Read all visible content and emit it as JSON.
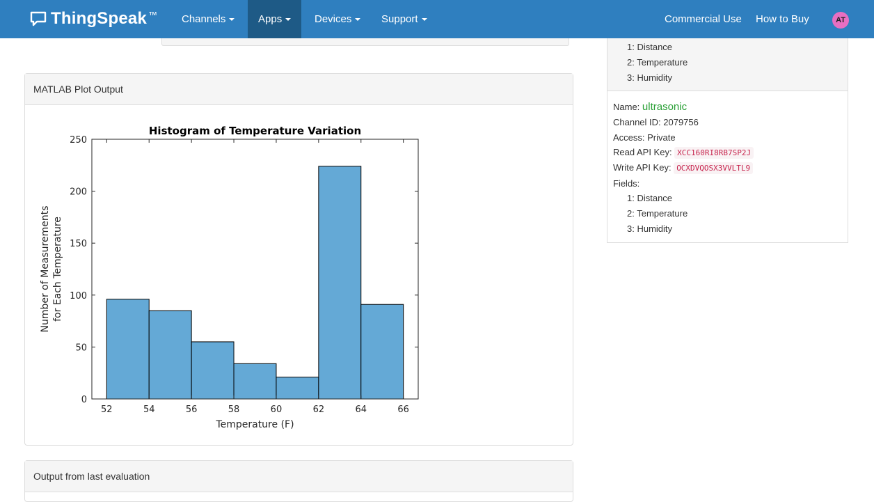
{
  "navbar": {
    "brand": "ThingSpeak",
    "brand_tm": "™",
    "items": [
      {
        "label": "Channels"
      },
      {
        "label": "Apps"
      },
      {
        "label": "Devices"
      },
      {
        "label": "Support"
      }
    ],
    "right_items": [
      {
        "label": "Commercial Use"
      },
      {
        "label": "How to Buy"
      }
    ],
    "avatar_initials": "AT",
    "colors": {
      "bar": "#2f7fbf",
      "active": "#1e5a86",
      "avatar": "#e86fc2"
    }
  },
  "sidebar_top": {
    "fields": [
      "1: Distance",
      "2: Temperature",
      "3: Humidity"
    ]
  },
  "channel": {
    "name_label": "Name: ",
    "name_value": "ultrasonic",
    "id_line": "Channel ID: 2079756",
    "access_line": "Access: Private",
    "read_key_label": "Read API Key: ",
    "read_key": "XCC160RI8RB7SP2J",
    "write_key_label": "Write API Key: ",
    "write_key": "OCXDVQOSX3VVLTL9",
    "fields_label": "Fields:",
    "fields": [
      "1: Distance",
      "2: Temperature",
      "3: Humidity"
    ]
  },
  "plot_panel": {
    "heading": "MATLAB Plot Output"
  },
  "output_panel": {
    "heading": "Output from last evaluation"
  },
  "chart_data": {
    "type": "bar",
    "title": "Histogram of Temperature Variation",
    "xlabel": "Temperature (F)",
    "ylabel_lines": [
      "Number of Measurements",
      "for Each Temperature"
    ],
    "bin_edges": [
      52,
      54,
      56,
      58,
      60,
      62,
      64,
      66
    ],
    "values": [
      96,
      85,
      55,
      34,
      21,
      224,
      91
    ],
    "xlim": [
      51.3,
      66.7
    ],
    "ylim": [
      0,
      250
    ],
    "xticks": [
      52,
      54,
      56,
      58,
      60,
      62,
      64,
      66
    ],
    "yticks": [
      0,
      50,
      100,
      150,
      200,
      250
    ],
    "bar_color": "#64a9d6",
    "grid": false
  }
}
